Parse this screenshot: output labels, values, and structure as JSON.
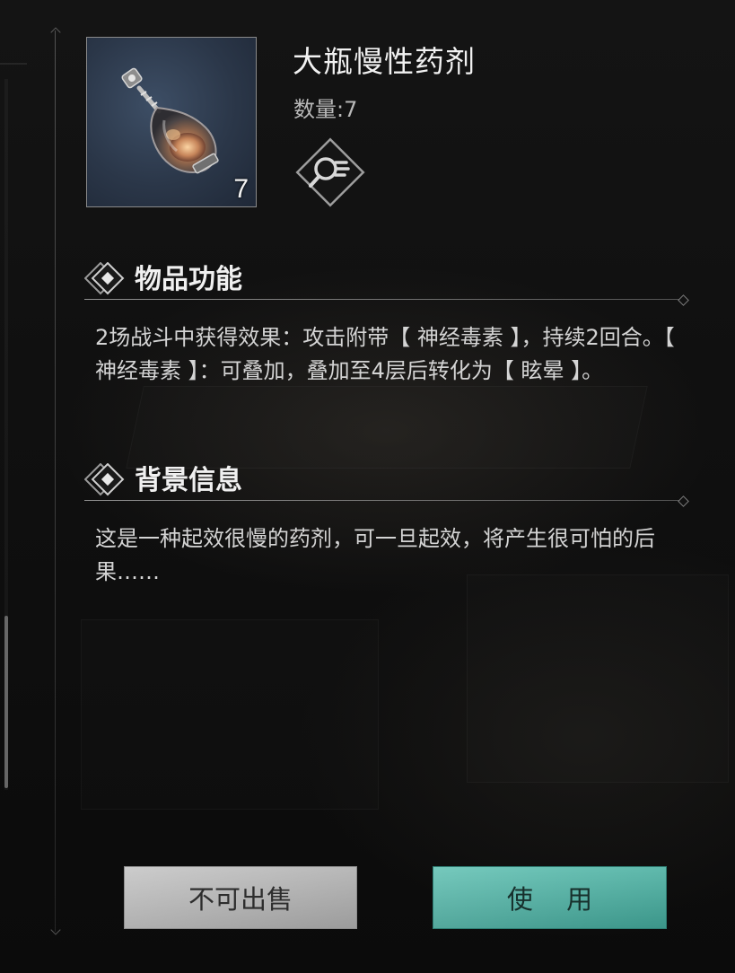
{
  "item": {
    "name": "大瓶慢性药剂",
    "quantity_label": "数量:7",
    "stack_count": "7",
    "icon": "potion-bottle-icon"
  },
  "inspect_button": {
    "icon": "magnify-inspect-icon"
  },
  "sections": {
    "function": {
      "title": "物品功能",
      "text": "2场战斗中获得效果：攻击附带【 神经毒素 】，持续2回合。【 神经毒素 】：可叠加，叠加至4层后转化为【 眩晕 】。"
    },
    "background": {
      "title": "背景信息",
      "text": "这是一种起效很慢的药剂，可一旦起效，将产生很可怕的后果……"
    }
  },
  "buttons": {
    "no_sale": "不可出售",
    "use": "使 用"
  },
  "colors": {
    "use_button": "#4fb0a3",
    "no_sale_button": "#b6b6b6",
    "icon_bg": "#2b3749"
  }
}
